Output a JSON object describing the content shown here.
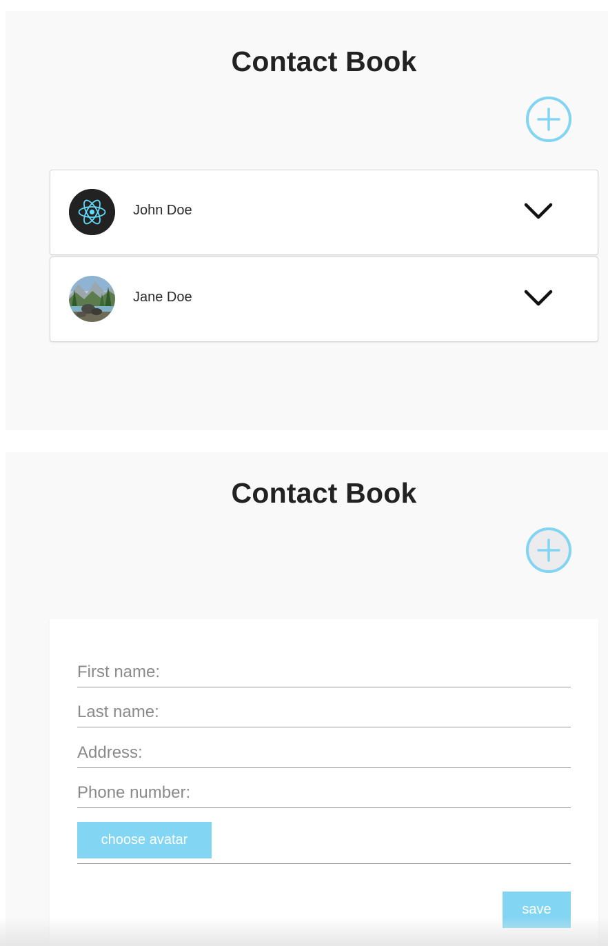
{
  "screens": [
    {
      "title": "Contact Book",
      "contacts": [
        {
          "name": "John Doe",
          "avatar": "react-logo"
        },
        {
          "name": "Jane Doe",
          "avatar": "landscape-photo"
        }
      ]
    },
    {
      "title": "Contact Book",
      "form": {
        "first_name_placeholder": "First name:",
        "last_name_placeholder": "Last name:",
        "address_placeholder": "Address:",
        "phone_placeholder": "Phone number:",
        "choose_avatar_label": "choose avatar",
        "save_label": "save"
      }
    }
  ],
  "colors": {
    "accent": "#82d6f4",
    "panel_bg": "#f9f9f9",
    "title": "#222222"
  },
  "icons": {
    "add": "plus-circle-icon",
    "expand": "chevron-down-icon",
    "react_avatar": "react-logo-icon"
  }
}
